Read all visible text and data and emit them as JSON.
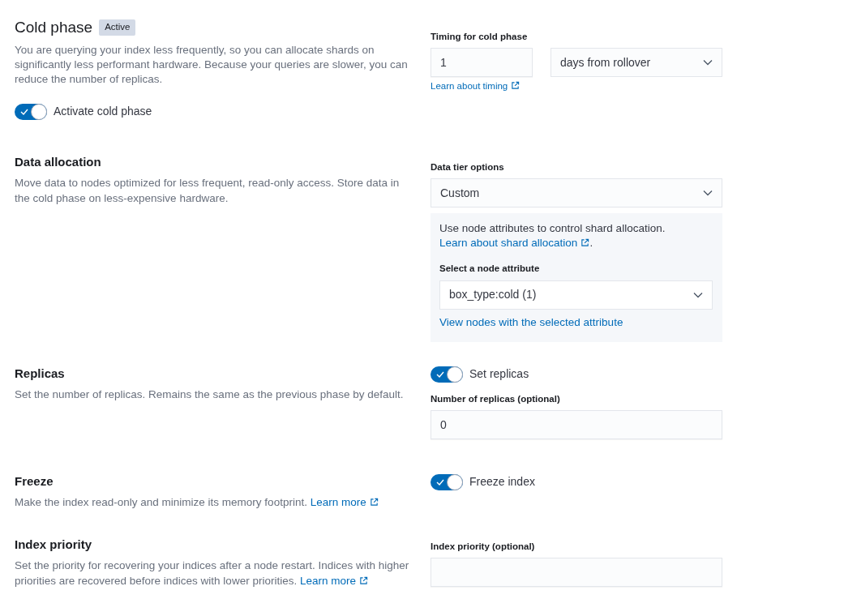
{
  "cold_phase": {
    "title": "Cold phase",
    "badge": "Active",
    "description": "You are querying your index less frequently, so you can allocate shards on significantly less performant hardware. Because your queries are slower, you can reduce the number of replicas.",
    "toggle": {
      "label": "Activate cold phase",
      "on": true
    },
    "timing": {
      "label": "Timing for cold phase",
      "value": "1",
      "unit": "days from rollover",
      "link": "Learn about timing"
    }
  },
  "data_allocation": {
    "title": "Data allocation",
    "description": "Move data to nodes optimized for less frequent, read-only access. Store data in the cold phase on less-expensive hardware.",
    "tier_label": "Data tier options",
    "tier_value": "Custom",
    "panel": {
      "text": "Use node attributes to control shard allocation.",
      "link": "Learn about shard allocation",
      "after": ".",
      "attribute_label": "Select a node attribute",
      "attribute_value": "box_type:cold (1)",
      "view_link": "View nodes with the selected attribute"
    }
  },
  "replicas": {
    "title": "Replicas",
    "description": "Set the number of replicas. Remains the same as the previous phase by default.",
    "toggle": {
      "label": "Set replicas",
      "on": true
    },
    "field_label": "Number of replicas (optional)",
    "value": "0"
  },
  "freeze": {
    "title": "Freeze",
    "description": "Make the index read-only and minimize its memory footprint.",
    "link": "Learn more",
    "toggle": {
      "label": "Freeze index",
      "on": true
    }
  },
  "index_priority": {
    "title": "Index priority",
    "description": "Set the priority for recovering your indices after a node restart. Indices with higher priorities are recovered before indices with lower priorities.",
    "link": "Learn more",
    "field_label": "Index priority (optional)"
  }
}
